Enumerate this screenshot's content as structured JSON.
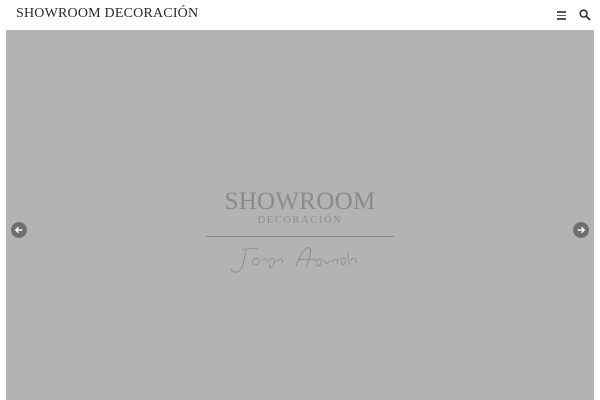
{
  "header": {
    "site_title": "SHOWROOM DECORACIÓN",
    "menu_icon": "hamburger-menu-icon",
    "search_icon": "search-icon"
  },
  "hero": {
    "background_color": "#b3b3b3",
    "logo": {
      "wordmark": "SHOWROOM",
      "subtitle": "DECORACIÓN",
      "signature": "Jorge Aguado"
    },
    "prev_icon": "arrow-left-icon",
    "next_icon": "arrow-right-icon"
  }
}
